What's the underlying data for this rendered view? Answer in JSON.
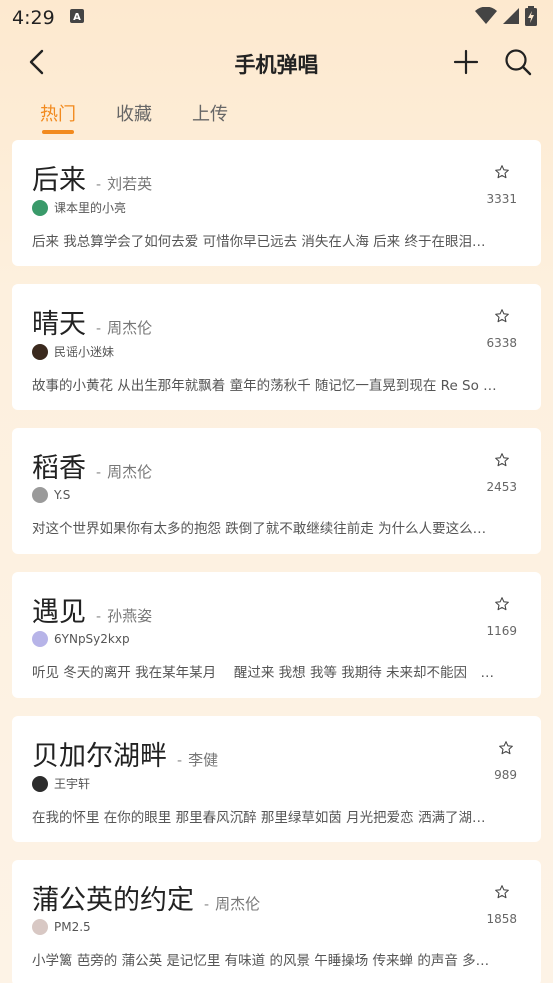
{
  "status": {
    "time": "4:29"
  },
  "appbar": {
    "title": "手机弹唱"
  },
  "tabs": [
    {
      "label": "热门",
      "active": true
    },
    {
      "label": "收藏",
      "active": false
    },
    {
      "label": "上传",
      "active": false
    }
  ],
  "songs": [
    {
      "title": "后来",
      "sep": "-",
      "artist": "刘若英",
      "uploader": "课本里的小亮",
      "count": "3331",
      "lyrics": "后来 我总算学会了如何去爱 可惜你早已远去 消失在人海 后来 终于在眼泪…",
      "avatar_color": "#3a9a6a"
    },
    {
      "title": "晴天",
      "sep": "-",
      "artist": "周杰伦",
      "uploader": "民谣小迷妹",
      "count": "6338",
      "lyrics": "故事的小黄花 从出生那年就飘着 童年的荡秋千 随记忆一直晃到现在 Re So …",
      "avatar_color": "#3b2a1e"
    },
    {
      "title": "稻香",
      "sep": "-",
      "artist": "周杰伦",
      "uploader": "Y.S",
      "count": "2453",
      "lyrics": "对这个世界如果你有太多的抱怨 跌倒了就不敢继续往前走 为什么人要这么…",
      "avatar_color": "#9a9a9a"
    },
    {
      "title": "遇见",
      "sep": "-",
      "artist": "孙燕姿",
      "uploader": "6YNpSy2kxp",
      "count": "1169",
      "lyrics": "听见 冬天的离开 我在某年某月　 醒过来 我想 我等 我期待 未来却不能因　…",
      "avatar_color": "#b7b4e8"
    },
    {
      "title": "贝加尔湖畔",
      "sep": "-",
      "artist": "李健",
      "uploader": "王宇轩",
      "count": "989",
      "lyrics": "在我的怀里 在你的眼里 那里春风沉醉 那里绿草如茵 月光把爱恋 洒满了湖…",
      "avatar_color": "#2c2c2c"
    },
    {
      "title": "蒲公英的约定",
      "sep": "-",
      "artist": "周杰伦",
      "uploader": "PM2.5",
      "count": "1858",
      "lyrics": "小学篱 芭旁的 蒲公英 是记忆里 有味道 的风景 午睡操场 传来蝉 的声音 多…",
      "avatar_color": "#d8c8c4"
    }
  ],
  "colors": {
    "accent": "#f28a1e",
    "background": "#fdeed9"
  },
  "icons": {
    "back": "chevron-left-icon",
    "add": "plus-icon",
    "search": "search-icon",
    "favorite": "star-outline-icon"
  }
}
